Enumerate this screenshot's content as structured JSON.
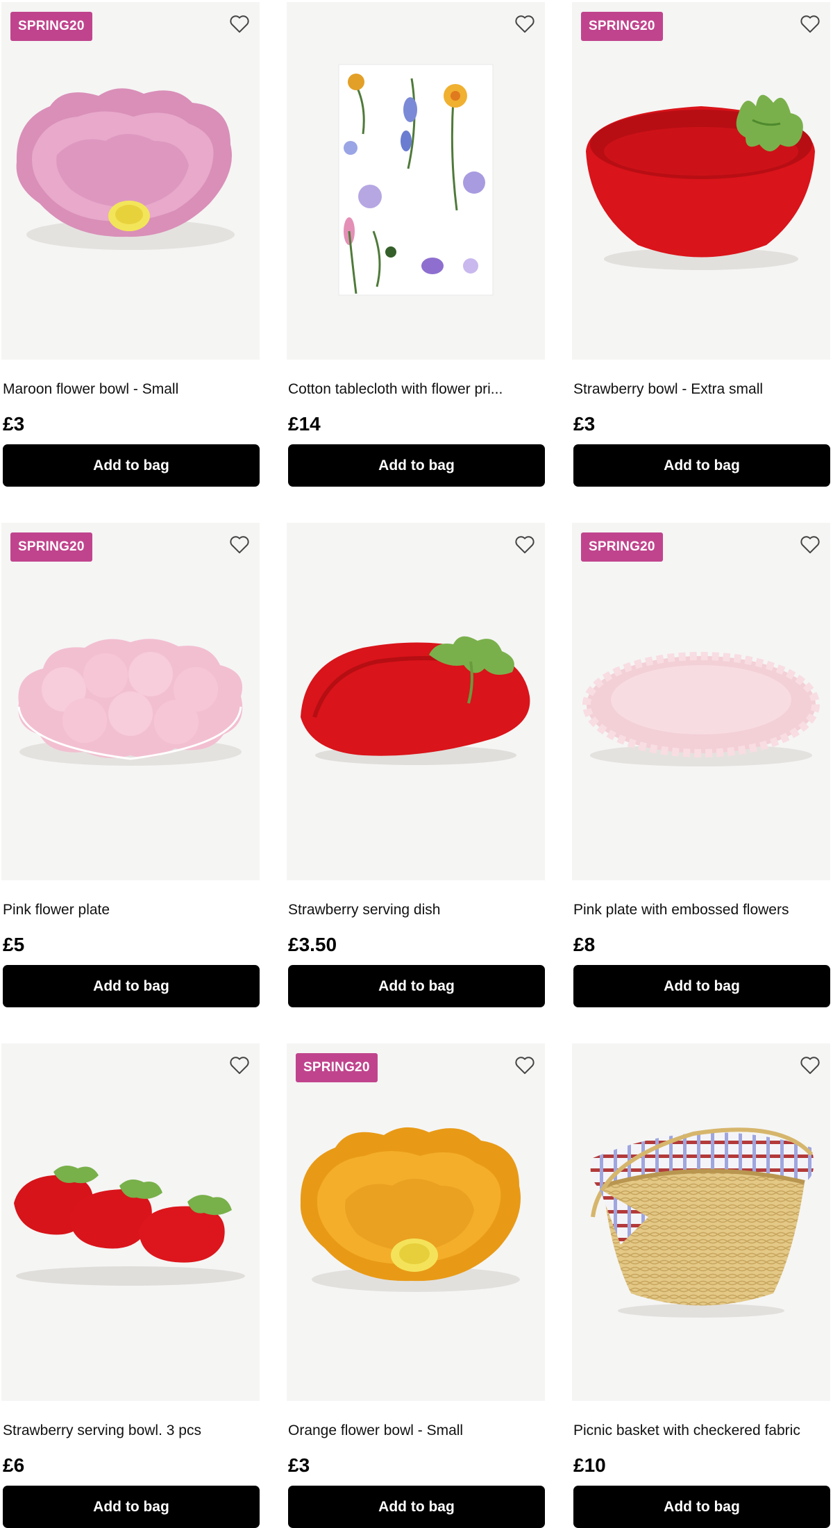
{
  "products": [
    {
      "name": "Maroon flower bowl - Small",
      "price": "£3",
      "badge": "SPRING20",
      "button": "Add to bag",
      "image": "pink-flower-bowl"
    },
    {
      "name": "Cotton tablecloth with flower pri...",
      "price": "£14",
      "badge": "",
      "button": "Add to bag",
      "image": "floral-tablecloth"
    },
    {
      "name": "Strawberry bowl - Extra small",
      "price": "£3",
      "badge": "SPRING20",
      "button": "Add to bag",
      "image": "strawberry-bowl"
    },
    {
      "name": "Pink flower plate",
      "price": "£5",
      "badge": "SPRING20",
      "button": "Add to bag",
      "image": "pink-flower-plate"
    },
    {
      "name": "Strawberry serving dish",
      "price": "£3.50",
      "badge": "",
      "button": "Add to bag",
      "image": "strawberry-dish"
    },
    {
      "name": "Pink plate with embossed flowers",
      "price": "£8",
      "badge": "SPRING20",
      "button": "Add to bag",
      "image": "pink-embossed-plate"
    },
    {
      "name": "Strawberry serving bowl. 3 pcs",
      "price": "£6",
      "badge": "",
      "button": "Add to bag",
      "image": "strawberry-bowls-3"
    },
    {
      "name": "Orange flower bowl - Small",
      "price": "£3",
      "badge": "SPRING20",
      "button": "Add to bag",
      "image": "orange-flower-bowl"
    },
    {
      "name": "Picnic basket with checkered fabric",
      "price": "£10",
      "badge": "",
      "button": "Add to bag",
      "image": "picnic-basket"
    }
  ],
  "icons": {
    "wishlist": "heart-outline-icon"
  },
  "colors": {
    "badge": "#c0448d",
    "button": "#000000",
    "image_bg": "#f5f5f4"
  }
}
